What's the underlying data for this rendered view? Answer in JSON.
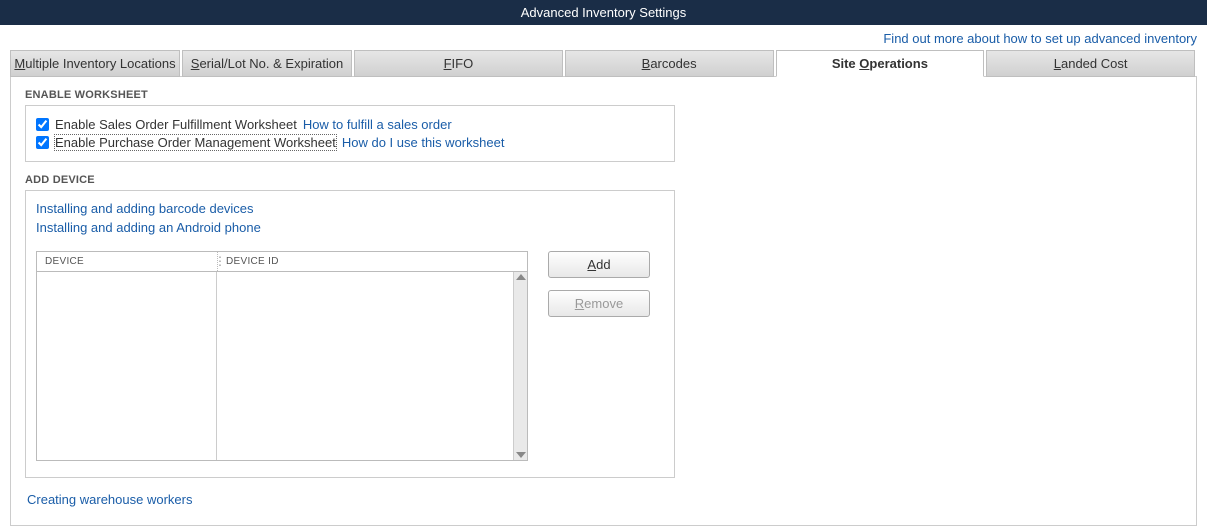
{
  "window": {
    "title": "Advanced Inventory Settings"
  },
  "top_link": "Find out more about how to set up advanced inventory",
  "tabs": {
    "multiple_locations": "Multiple Inventory Locations",
    "serial_lot": "Serial/Lot No. & Expiration",
    "fifo": "FIFO",
    "barcodes": "Barcodes",
    "site_operations": "Site Operations",
    "landed_cost": "Landed Cost"
  },
  "enable_worksheet": {
    "section_label": "ENABLE WORKSHEET",
    "opt1_label": "Enable Sales Order Fulfillment Worksheet",
    "opt1_checked": true,
    "opt1_help": "How to fulfill a sales order",
    "opt2_label": "Enable Purchase Order Management Worksheet",
    "opt2_checked": true,
    "opt2_help": "How do I use this worksheet"
  },
  "add_device": {
    "section_label": "ADD DEVICE",
    "link_barcode": "Installing and adding barcode devices",
    "link_android": "Installing and adding an Android phone",
    "col_device": "DEVICE",
    "col_device_id": "DEVICE ID",
    "add_button": "Add",
    "remove_button": "Remove"
  },
  "footer_link": "Creating warehouse workers"
}
